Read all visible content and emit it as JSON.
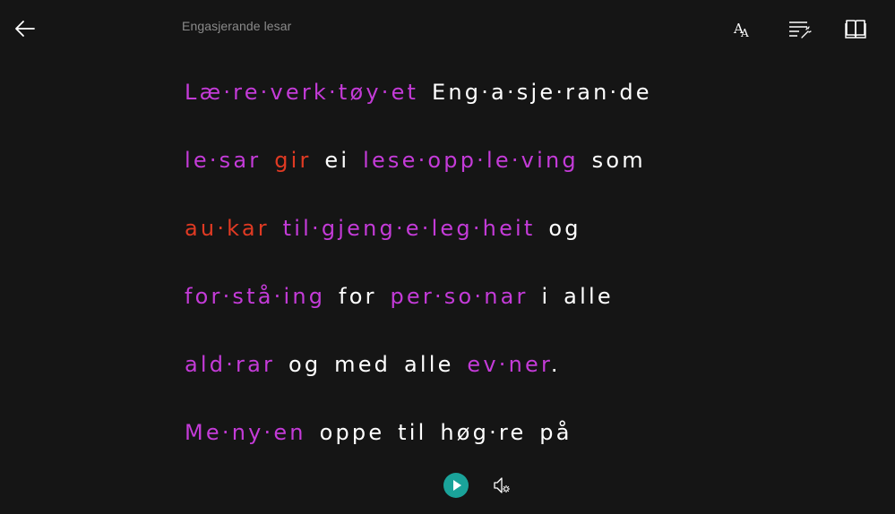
{
  "app": {
    "title": "Engasjerande lesar"
  },
  "toolbar": {
    "back_icon": "arrow-left-icon",
    "text_options_icon": "text-size-icon",
    "grammar_options_icon": "grammar-options-icon",
    "reading_preferences_icon": "book-icon"
  },
  "colors": {
    "background": "#151515",
    "plain_text": "#ffffff",
    "noun": "#c43bd8",
    "verb": "#e03a23",
    "adjective": "#b44fe0",
    "play_button": "#1aa39a"
  },
  "reader": {
    "lines": [
      [
        {
          "text": "Læ·re·verk·tøy·et",
          "pos": "noun"
        },
        {
          "text": "Eng·a·sje·ran·de",
          "pos": "plain"
        }
      ],
      [
        {
          "text": "le·sar",
          "pos": "noun"
        },
        {
          "text": "gir",
          "pos": "verb"
        },
        {
          "text": "ei",
          "pos": "plain"
        },
        {
          "text": "lese·opp·le·ving",
          "pos": "noun"
        },
        {
          "text": "som",
          "pos": "plain"
        }
      ],
      [
        {
          "text": "au·kar",
          "pos": "verb"
        },
        {
          "text": "til·gjeng·e·leg·heit",
          "pos": "noun"
        },
        {
          "text": "og",
          "pos": "plain"
        }
      ],
      [
        {
          "text": "for·stå·ing",
          "pos": "noun"
        },
        {
          "text": "for",
          "pos": "plain"
        },
        {
          "text": "per·so·nar",
          "pos": "noun"
        },
        {
          "text": "i",
          "pos": "plain"
        },
        {
          "text": "alle",
          "pos": "plain"
        }
      ],
      [
        {
          "text": "ald·rar",
          "pos": "noun"
        },
        {
          "text": "og",
          "pos": "plain"
        },
        {
          "text": "med",
          "pos": "plain"
        },
        {
          "text": "alle",
          "pos": "plain"
        },
        {
          "text": "ev·ner",
          "pos": "noun"
        },
        {
          "text": ".",
          "pos": "plain"
        }
      ],
      [
        {
          "text": "Me·ny·en",
          "pos": "noun"
        },
        {
          "text": "oppe",
          "pos": "plain"
        },
        {
          "text": "til",
          "pos": "plain"
        },
        {
          "text": "høg·re",
          "pos": "plain"
        },
        {
          "text": "på",
          "pos": "plain"
        }
      ]
    ]
  },
  "playback": {
    "play_icon": "play-icon",
    "voice_settings_icon": "voice-settings-icon"
  }
}
